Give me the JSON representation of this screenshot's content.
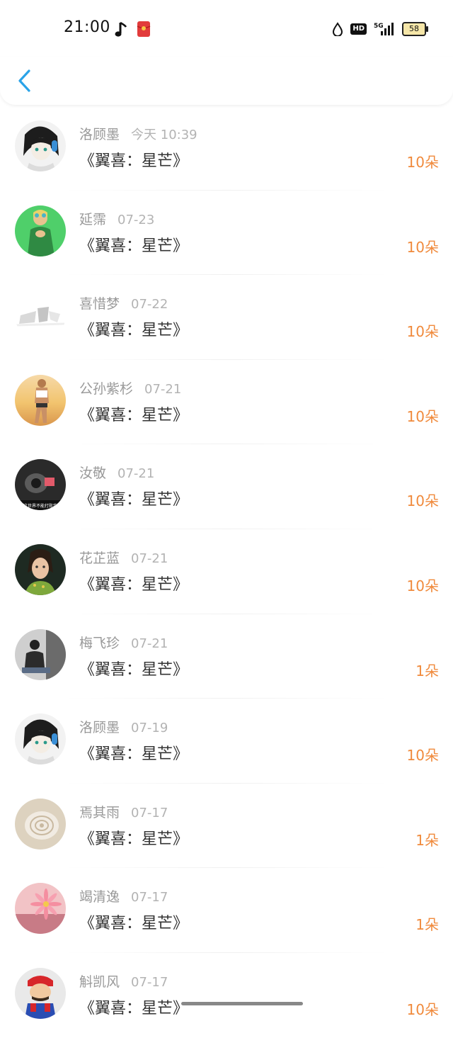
{
  "status_bar": {
    "time": "21:00",
    "battery": "58",
    "hd_label": "HD",
    "network_label": "5G",
    "icons": [
      "music-note-icon",
      "red-packet-icon",
      "water-drop-icon",
      "hd-icon",
      "signal-icon",
      "battery-icon"
    ]
  },
  "header": {
    "back_icon": "chevron-left-icon",
    "accent_color": "#2aa3e8"
  },
  "colors": {
    "amount": "#f08a3c",
    "name": "#999999",
    "date": "#b3b3b3",
    "title": "#333333"
  },
  "records": [
    {
      "name": "洛顾墨",
      "date": "今天 10:39",
      "title": "《翼喜：星芒》",
      "amount": "10朵",
      "avatar": "avatar-anime-headphones"
    },
    {
      "name": "延霈",
      "date": "07-23",
      "title": "《翼喜：星芒》",
      "amount": "10朵",
      "avatar": "avatar-green-dress"
    },
    {
      "name": "喜惜梦",
      "date": "07-22",
      "title": "《翼喜：星芒》",
      "amount": "10朵",
      "avatar": "avatar-gray-abstract"
    },
    {
      "name": "公孙紫杉",
      "date": "07-21",
      "title": "《翼喜：星芒》",
      "amount": "10朵",
      "avatar": "avatar-beach"
    },
    {
      "name": "汝敬",
      "date": "07-21",
      "title": "《翼喜：星芒》",
      "amount": "10朵",
      "avatar": "avatar-dark-photo",
      "avatar_caption": "这世界不能打败我"
    },
    {
      "name": "花芷蓝",
      "date": "07-21",
      "title": "《翼喜：星芒》",
      "amount": "10朵",
      "avatar": "avatar-portrait-woman"
    },
    {
      "name": "梅飞珍",
      "date": "07-21",
      "title": "《翼喜：星芒》",
      "amount": "1朵",
      "avatar": "avatar-sitting-man"
    },
    {
      "name": "洛顾墨",
      "date": "07-19",
      "title": "《翼喜：星芒》",
      "amount": "10朵",
      "avatar": "avatar-anime-headphones"
    },
    {
      "name": "焉其雨",
      "date": "07-17",
      "title": "《翼喜：星芒》",
      "amount": "1朵",
      "avatar": "avatar-seashell"
    },
    {
      "name": "竭清逸",
      "date": "07-17",
      "title": "《翼喜：星芒》",
      "amount": "1朵",
      "avatar": "avatar-pink-flower"
    },
    {
      "name": "斛凯风",
      "date": "07-17",
      "title": "《翼喜：星芒》",
      "amount": "10朵",
      "avatar": "avatar-red-character"
    }
  ]
}
